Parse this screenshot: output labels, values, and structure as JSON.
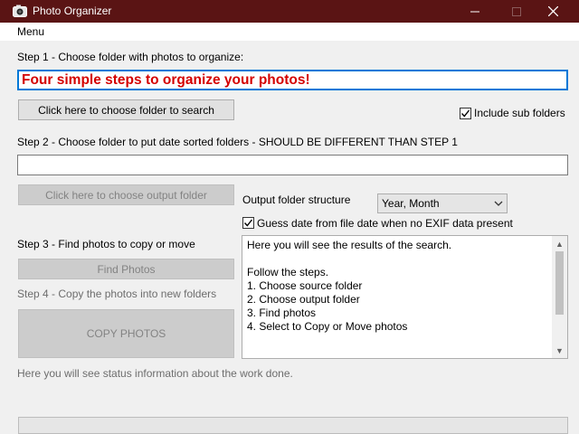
{
  "window": {
    "title": "Photo Organizer",
    "accent_color": "#5a1414"
  },
  "menu": {
    "items": [
      "Menu"
    ]
  },
  "step1": {
    "label": "Step 1 - Choose folder with photos to organize:",
    "intro_text": "Four simple steps to organize your photos!",
    "choose_button": "Click here to choose folder to search",
    "include_sub_label": "Include sub folders",
    "include_sub_checked": true
  },
  "step2": {
    "label": "Step 2 - Choose folder to put date sorted folders - SHOULD BE DIFFERENT THAN STEP 1",
    "output_value": "",
    "choose_button": "Click here to choose output folder",
    "structure_label": "Output folder structure",
    "structure_value": "Year, Month",
    "guess_date_label": "Guess date from file date when no EXIF data present",
    "guess_date_checked": true
  },
  "step3": {
    "label": "Step 3 - Find photos to copy or move",
    "find_button": "Find Photos"
  },
  "step4": {
    "label": "Step 4 - Copy the photos into new folders",
    "copy_button": "COPY PHOTOS"
  },
  "results": {
    "text": "Here you will see the results of the search.\n\nFollow the steps.\n1. Choose source folder\n2. Choose output folder\n3. Find photos\n4. Select to Copy or Move photos"
  },
  "status": {
    "text": "Here you will see status information about the work done."
  },
  "progress": {
    "value": 0
  }
}
